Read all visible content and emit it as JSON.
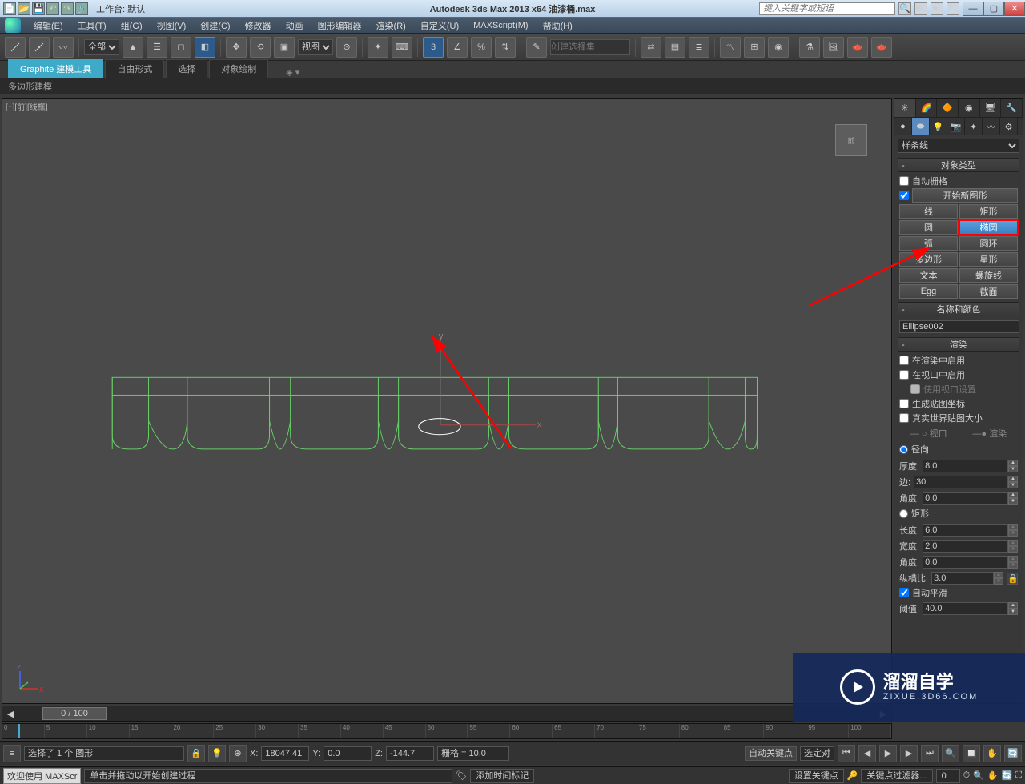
{
  "titlebar": {
    "workspace_label": "工作台: 默认",
    "app_title": "Autodesk 3ds Max  2013 x64     油漆桶.max",
    "search_placeholder": "键入关键字或短语"
  },
  "menus": [
    "编辑(E)",
    "工具(T)",
    "组(G)",
    "视图(V)",
    "创建(C)",
    "修改器",
    "动画",
    "图形编辑器",
    "渲染(R)",
    "自定义(U)",
    "MAXScript(M)",
    "帮助(H)"
  ],
  "toolbar": {
    "filter": "全部",
    "view_select": "视图",
    "named_sel_placeholder": "创建选择集"
  },
  "ribbon": {
    "tabs": [
      "Graphite 建模工具",
      "自由形式",
      "选择",
      "对象绘制"
    ],
    "active": 0,
    "sub": "多边形建模"
  },
  "viewport": {
    "label": "[+][前][线框]",
    "viewcube": "前"
  },
  "panel": {
    "spline_dropdown": "样条线",
    "obj_type_hdr": "对象类型",
    "auto_grid": "自动栅格",
    "start_new_shape": "开始新图形",
    "buttons": [
      [
        "线",
        "矩形"
      ],
      [
        "圆",
        "椭圆"
      ],
      [
        "弧",
        "圆环"
      ],
      [
        "多边形",
        "星形"
      ],
      [
        "文本",
        "螺旋线"
      ],
      [
        "Egg",
        "截面"
      ]
    ],
    "name_color_hdr": "名称和颜色",
    "obj_name": "Ellipse002",
    "render_hdr": "渲染",
    "enable_render": "在渲染中启用",
    "enable_viewport": "在视口中启用",
    "use_viewport": "使用视口设置",
    "gen_map_coords": "生成贴图坐标",
    "real_world": "真实世界贴图大小",
    "viewport_radio": "视口",
    "render_radio": "渲染",
    "radial": "径向",
    "thickness_lbl": "厚度:",
    "thickness": "8.0",
    "sides_lbl": "边:",
    "sides": "30",
    "angle_lbl": "角度:",
    "angle": "0.0",
    "rect": "矩形",
    "length_lbl": "长度:",
    "length": "6.0",
    "width_lbl": "宽度:",
    "width": "2.0",
    "angle2_lbl": "角度:",
    "angle2": "0.0",
    "aspect_lbl": "纵横比:",
    "aspect": "3.0",
    "autosmooth": "自动平滑",
    "threshold_lbl": "阈值:",
    "threshold": "40.0"
  },
  "timeline": {
    "label": "0 / 100"
  },
  "status": {
    "selection": "选择了 1 个 图形",
    "x_lbl": "X:",
    "x": "18047.41",
    "y_lbl": "Y:",
    "y": "0.0",
    "z_lbl": "Z:",
    "z": "-144.7",
    "grid": "栅格 = 10.0",
    "autokey": "自动关键点",
    "selected": "选定对",
    "setkey": "设置关键点",
    "keyfilter": "关键点过滤器...",
    "addtime": "添加时间标记"
  },
  "status2": {
    "welcome": "欢迎使用 MAXScr",
    "prompt": "单击并拖动以开始创建过程"
  },
  "watermark": {
    "brand": "溜溜自学",
    "url": "ZIXUE.3D66.COM"
  },
  "axis": {
    "y": "y",
    "x": "x",
    "z": "z"
  }
}
